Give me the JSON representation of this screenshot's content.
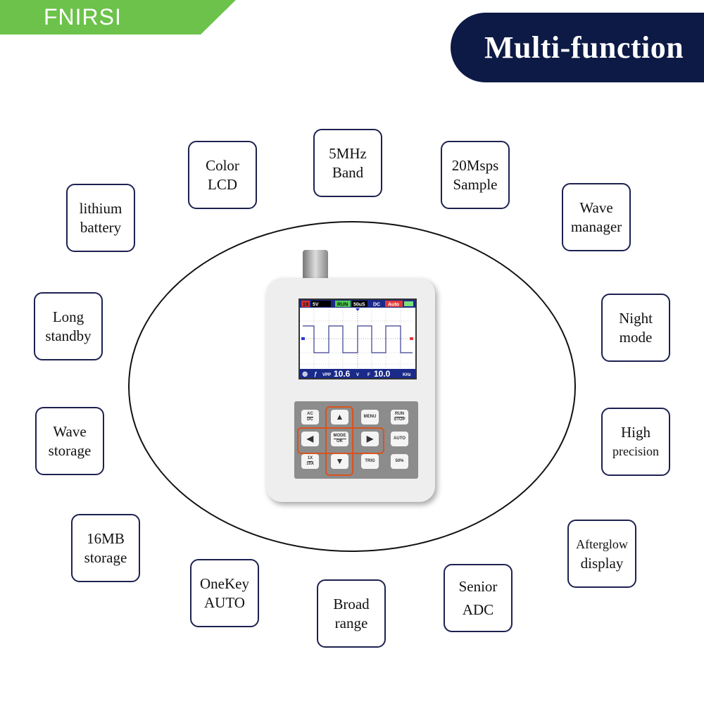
{
  "brand": {
    "logo": "FNIRSI",
    "band_color": "#6cc24a"
  },
  "header": {
    "title": "Multi-function",
    "pill_color": "#0d1a45"
  },
  "features": [
    {
      "l1": "Color",
      "l2": "LCD"
    },
    {
      "l1": "5MHz",
      "l2": "Band"
    },
    {
      "l1": "20Msps",
      "l2": "Sample"
    },
    {
      "l1": "lithium",
      "l2": "battery"
    },
    {
      "l1": "Wave",
      "l2": "manager"
    },
    {
      "l1": "Long",
      "l2": "standby"
    },
    {
      "l1": "Night",
      "l2": "mode"
    },
    {
      "l1": "Wave",
      "l2": "storage"
    },
    {
      "l1": "High",
      "l2": "precision"
    },
    {
      "l1": "16MB",
      "l2": "storage"
    },
    {
      "l1": "Afterglow",
      "l2": "display"
    },
    {
      "l1": "OneKey",
      "l2": "AUTO"
    },
    {
      "l1": "Broad",
      "l2": "range"
    },
    {
      "l1": "Senior",
      "l2": "ADC"
    }
  ],
  "screen": {
    "probe": "1X",
    "volts": "5V",
    "state": "RUN",
    "timebase": "50uS",
    "coupling": "DC",
    "trigger": "Auto",
    "vpp_label": "VPP",
    "vpp": "10.6",
    "vpp_unit": "V",
    "f_label": "F",
    "freq": "10.0",
    "freq_unit": "KHz"
  },
  "keys": {
    "acdc_top": "AC",
    "acdc_bot": "DC",
    "menu": "MENU",
    "run_top": "RUN",
    "run_bot": "STOP",
    "mode_top": "MODE",
    "mode_bot": "OK",
    "auto": "AUTO",
    "x_top": "1X",
    "x_bot": "10X",
    "trig": "TRIG",
    "fifty": "50%"
  }
}
